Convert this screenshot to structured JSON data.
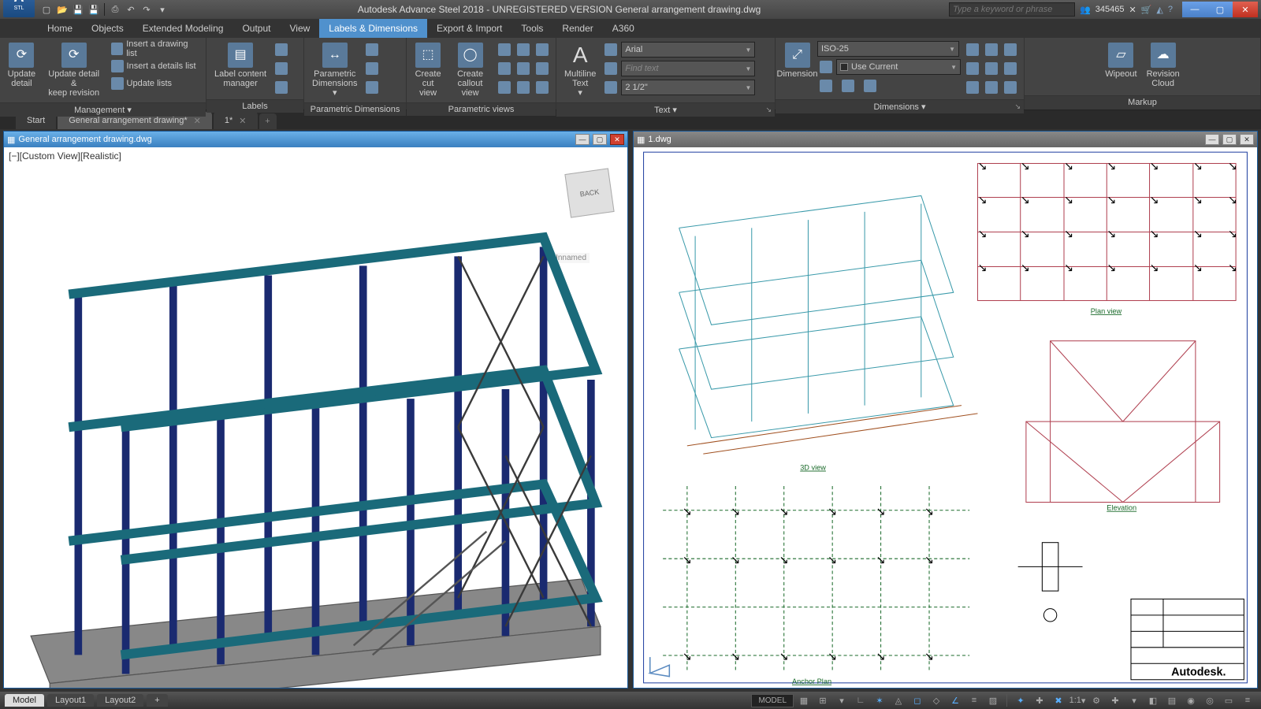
{
  "app": {
    "title": "Autodesk Advance Steel 2018 - UNREGISTERED VERSION   General arrangement drawing.dwg",
    "search_placeholder": "Type a keyword or phrase",
    "user_count": "345465",
    "logo_letter": "A",
    "logo_sub": "STL"
  },
  "menu": {
    "tabs": [
      "Home",
      "Objects",
      "Extended Modeling",
      "Output",
      "View",
      "Labels & Dimensions",
      "Export & Import",
      "Tools",
      "Render",
      "A360"
    ],
    "active": "Labels & Dimensions"
  },
  "ribbon": {
    "management": {
      "label": "Management",
      "update_detail": "Update\ndetail",
      "update_keep": "Update detail &\nkeep revision",
      "insert_drawing_list": "Insert a drawing list",
      "insert_details_list": "Insert a details list",
      "update_lists": "Update lists"
    },
    "labels": {
      "label": "Labels",
      "label_content_manager": "Label content\nmanager"
    },
    "parametric": {
      "label": "Parametric Dimensions",
      "parametric_dimensions": "Parametric\nDimensions"
    },
    "views": {
      "label": "Parametric views",
      "create_cut_view": "Create\ncut view",
      "create_callout_view": "Create\ncallout view"
    },
    "text": {
      "label": "Text",
      "multiline_text": "Multiline\nText",
      "font": "Arial",
      "find_placeholder": "Find text",
      "size": "2 1/2\""
    },
    "dimensions": {
      "label": "Dimensions",
      "dimension": "Dimension",
      "style": "ISO-25",
      "use_current": "Use Current"
    },
    "markup": {
      "label": "Markup",
      "wipeout": "Wipeout",
      "revision_cloud": "Revision\nCloud"
    }
  },
  "doctabs": {
    "tabs": [
      {
        "label": "Start",
        "closable": false
      },
      {
        "label": "General arrangement drawing*",
        "closable": true,
        "active": true
      },
      {
        "label": "1*",
        "closable": true
      }
    ]
  },
  "docwins": [
    {
      "title": "General arrangement drawing.dwg",
      "view_label": "[−][Custom View][Realistic]",
      "viewcube": "BACK",
      "tag": "Unnamed"
    },
    {
      "title": "1.dwg",
      "captions": {
        "threeD": "3D view",
        "plan": "Plan view",
        "anchor": "Anchor Plan",
        "elevation": "Elevation",
        "brand": "Autodesk."
      }
    }
  ],
  "layout": {
    "tabs": [
      "Model",
      "Layout1",
      "Layout2"
    ],
    "active": "Model"
  },
  "status": {
    "model": "MODEL",
    "scale": "1:1"
  }
}
